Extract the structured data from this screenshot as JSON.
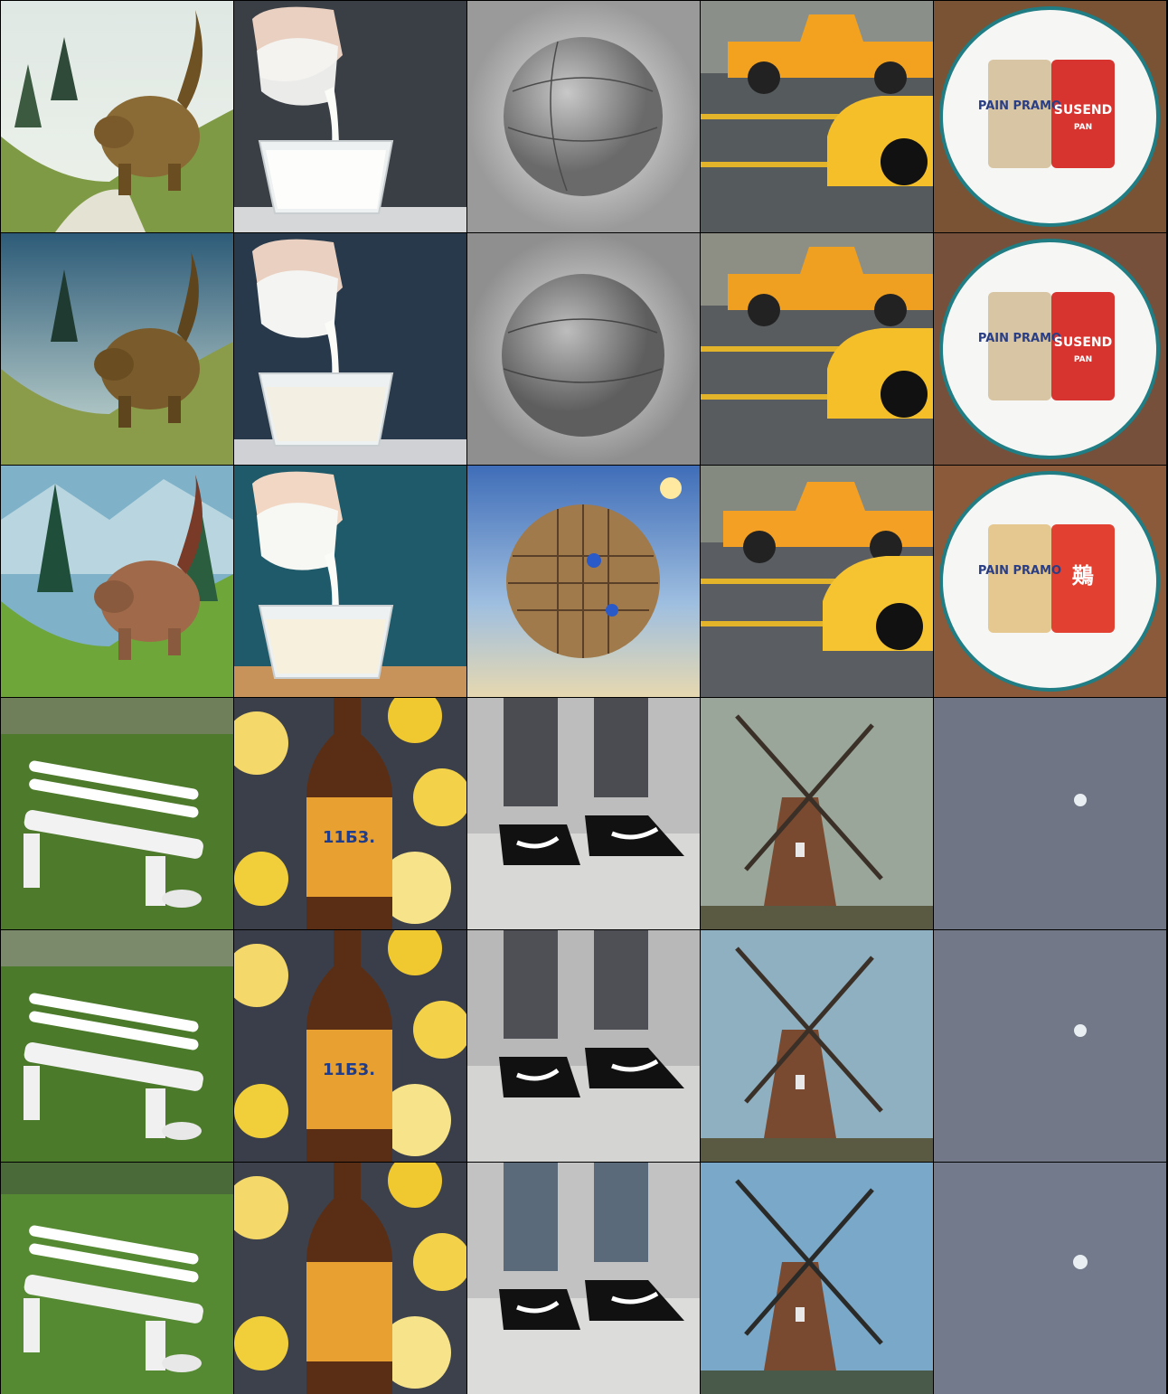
{
  "grid": {
    "columns": 5,
    "rows": 6,
    "subjects": [
      [
        "rhino",
        "milk-pour",
        "sphere",
        "truck-and-car",
        "cans-on-plate"
      ],
      [
        "bench",
        "lemon-beer-bottle",
        "sneakers",
        "windmill",
        "moon-sky"
      ]
    ]
  },
  "labels": {
    "can_left": "PAIN PRAMO",
    "can_right": "SUSEND",
    "can_right_sub": "PAN",
    "can_right_alt": "鶧",
    "bottle_label": "11Б3."
  },
  "colors": {
    "truck": "#f2a21e",
    "car": "#f5bf2a",
    "grass": "#4e7a2c",
    "brick": "#7a4a30",
    "moon_sky": "#6f7585"
  }
}
